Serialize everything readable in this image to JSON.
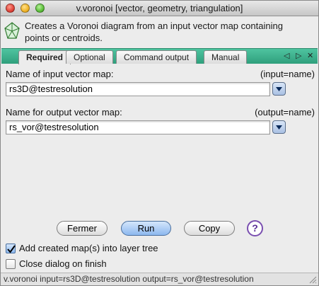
{
  "window": {
    "title": "v.voronoi [vector, geometry, triangulation]"
  },
  "header": {
    "description": "Creates a Voronoi diagram from an input vector map containing points or centroids."
  },
  "tabs": [
    {
      "label": "Required",
      "active": true
    },
    {
      "label": "Optional",
      "active": false
    },
    {
      "label": "Command output",
      "active": false
    },
    {
      "label": "Manual",
      "active": false
    }
  ],
  "tab_nav": {
    "left": "◁",
    "right": "▷",
    "close": "✕"
  },
  "fields": {
    "input": {
      "label": "Name of input vector map:",
      "param": "(input=name)",
      "value": "rs3D@testresolution"
    },
    "output": {
      "label": "Name for output vector map:",
      "param": "(output=name)",
      "value": "rs_vor@testresolution"
    }
  },
  "buttons": {
    "close": "Fermer",
    "run": "Run",
    "copy": "Copy",
    "help": "?"
  },
  "options": {
    "add_to_tree": {
      "label": "Add created map(s) into layer tree",
      "checked": true
    },
    "close_on_finish": {
      "label": "Close dialog on finish",
      "checked": false
    }
  },
  "statusbar": {
    "text": "v.voronoi input=rs3D@testresolution output=rs_vor@testresolution"
  },
  "colors": {
    "tab_strip": "#3fb38f",
    "run_button": "#8db8ef",
    "help_ring": "#7a4fb0"
  }
}
